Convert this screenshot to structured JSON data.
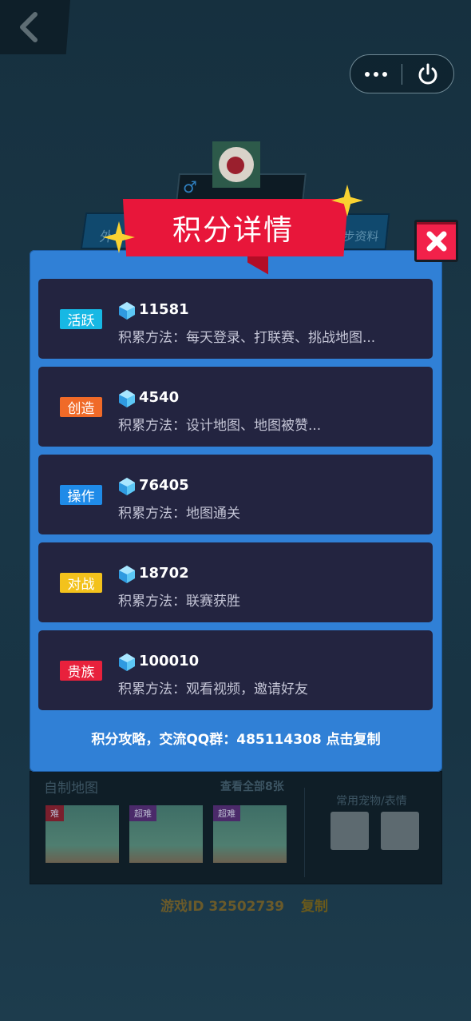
{
  "nav": {
    "back_icon": "chevron-left-icon",
    "more_icon": "more-dots-icon",
    "power_icon": "power-icon"
  },
  "background": {
    "tab_left_label": "外",
    "tab_right_label": "步资料",
    "gender_symbol": "♂",
    "maps_title": "自制地图",
    "view_all": "查看全部8张",
    "pets_title": "常用宠物/表情",
    "thumbs": [
      {
        "tag": "难"
      },
      {
        "tag": "超难"
      },
      {
        "tag": "超难"
      }
    ],
    "game_id": "游戏ID 32502739",
    "copy_label": "复制"
  },
  "modal": {
    "title": "积分详情",
    "close_icon": "close-x-icon",
    "rows": [
      {
        "tag": "活跃",
        "tag_color": "#17b8e4",
        "score": "11581",
        "method": "积累方法：每天登录、打联赛、挑战地图..."
      },
      {
        "tag": "创造",
        "tag_color": "#f06a28",
        "score": "4540",
        "method": "积累方法：设计地图、地图被赞..."
      },
      {
        "tag": "操作",
        "tag_color": "#1f8be8",
        "score": "76405",
        "method": "积累方法：地图通关"
      },
      {
        "tag": "对战",
        "tag_color": "#f3c21c",
        "score": "18702",
        "method": "积累方法：联赛获胜"
      },
      {
        "tag": "贵族",
        "tag_color": "#e8213c",
        "score": "100010",
        "method": "积累方法：观看视频，邀请好友"
      }
    ],
    "footer": "积分攻略，交流QQ群：485114308 点击复制"
  }
}
